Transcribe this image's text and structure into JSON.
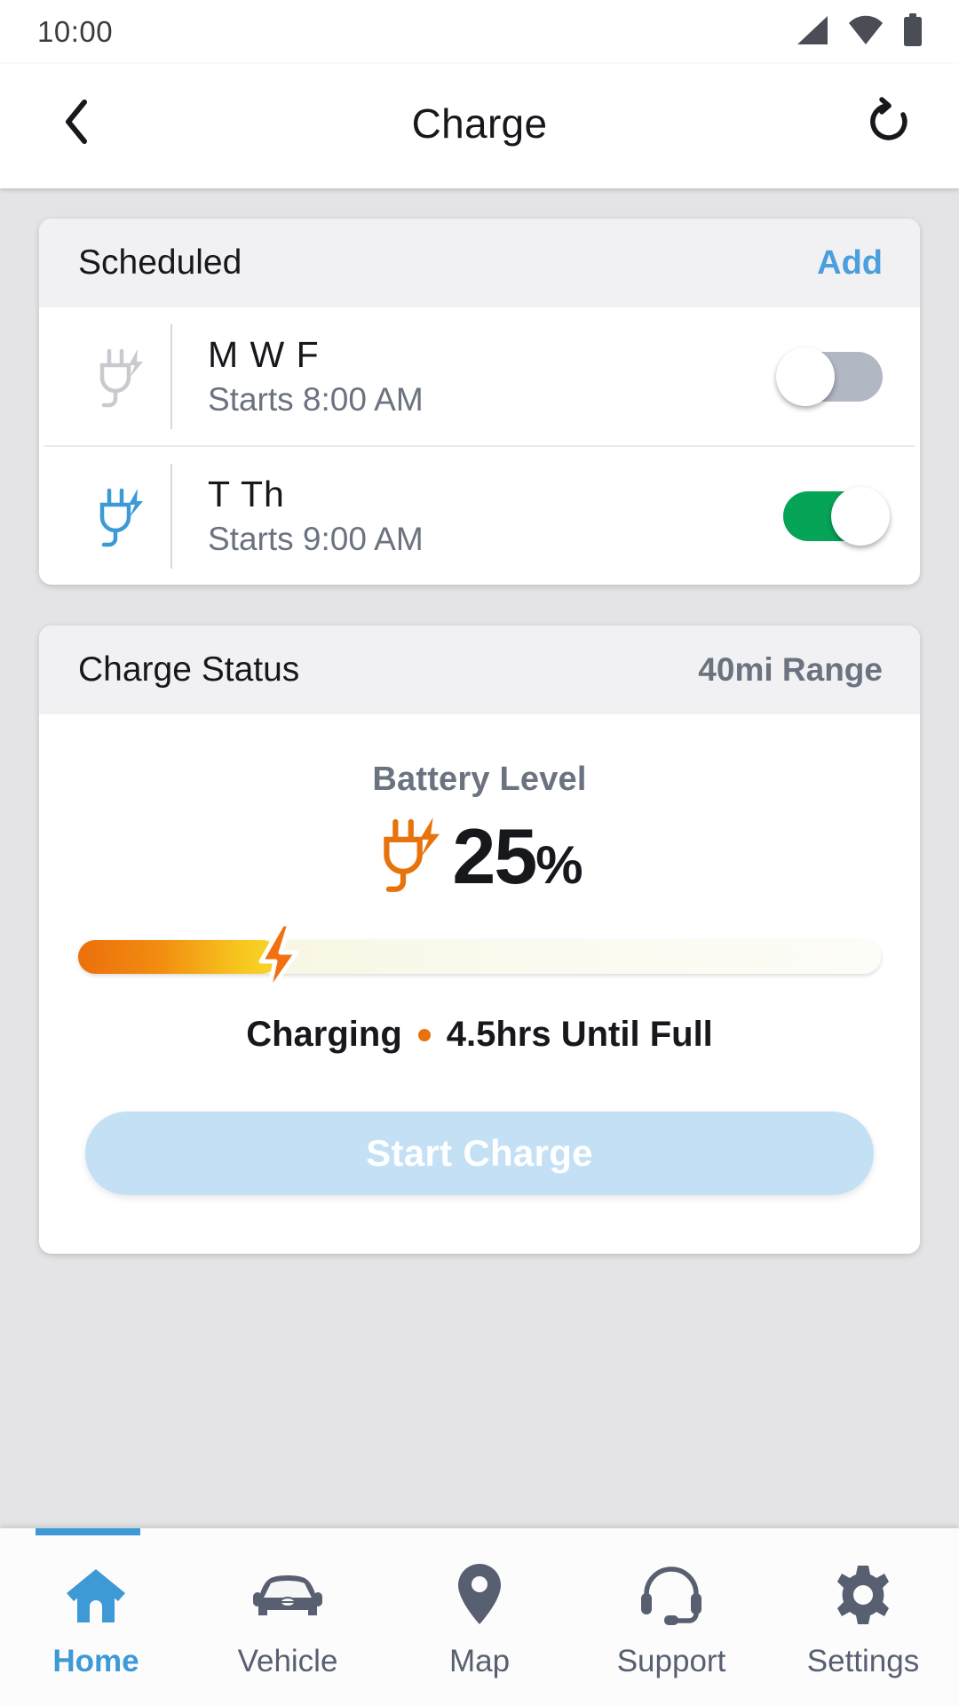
{
  "statusbar": {
    "time": "10:00",
    "icons": [
      "signal-icon",
      "wifi-icon",
      "battery-icon"
    ]
  },
  "header": {
    "back_icon": "chevron-left-icon",
    "title": "Charge",
    "refresh_icon": "refresh-ccw-icon"
  },
  "scheduled_card": {
    "title": "Scheduled",
    "add_label": "Add",
    "rows": [
      {
        "icon": "plug-charge-icon",
        "icon_color": "#c9c9cf",
        "days": "M W F",
        "time": "Starts 8:00 AM",
        "enabled": false
      },
      {
        "icon": "plug-charge-icon",
        "icon_color": "#3d9ad6",
        "days": "T Th",
        "time": "Starts 9:00 AM",
        "enabled": true
      }
    ]
  },
  "charge_status_card": {
    "title": "Charge Status",
    "range": "40mi Range",
    "battery_label": "Battery Level",
    "plug_icon": "plug-charge-icon",
    "battery_value": "25",
    "battery_symbol": "%",
    "battery_percent": 25,
    "bar_fill_percent": 25,
    "bolt_icon": "lightning-bolt-icon",
    "charging_state": "Charging",
    "separator_dot": "•",
    "time_until_full": "4.5hrs Until Full",
    "start_button_label": "Start Charge"
  },
  "bottom_nav": {
    "items": [
      {
        "label": "Home",
        "icon": "home-icon",
        "active": true
      },
      {
        "label": "Vehicle",
        "icon": "car-icon",
        "active": false
      },
      {
        "label": "Map",
        "icon": "map-pin-icon",
        "active": false
      },
      {
        "label": "Support",
        "icon": "headset-icon",
        "active": false
      },
      {
        "label": "Settings",
        "icon": "gear-icon",
        "active": false
      }
    ]
  },
  "colors": {
    "accent_blue": "#3d9ad6",
    "link_blue": "#4a9fdc",
    "toggle_on_green": "#06a457",
    "toggle_off_gray": "#b2b7c4",
    "charge_orange": "#e8730c",
    "page_bg": "#e4e4e6",
    "card_header_bg": "#f1f1f3",
    "text_primary": "#16181c",
    "text_secondary": "#6b7280"
  }
}
